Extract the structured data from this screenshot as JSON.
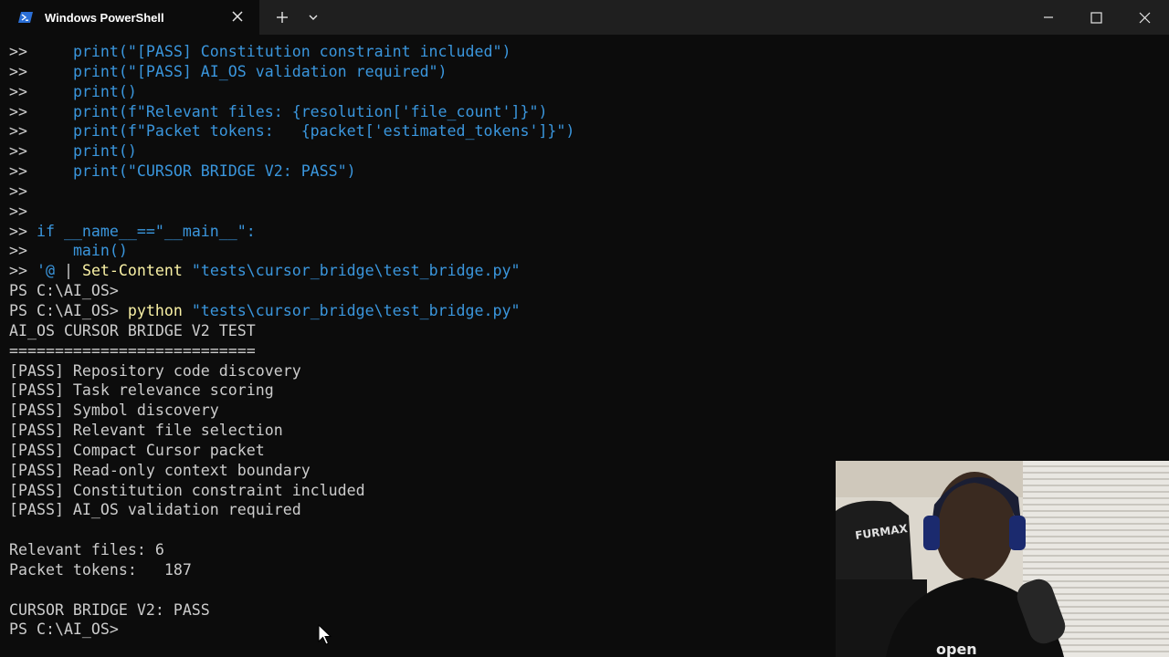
{
  "window": {
    "tab_title": "Windows PowerShell"
  },
  "terminal": {
    "lines": [
      [
        {
          "t": ">>     ",
          "c": "gray"
        },
        {
          "t": "print(\"[PASS] Constitution constraint included\")",
          "c": "blue"
        }
      ],
      [
        {
          "t": ">>     ",
          "c": "gray"
        },
        {
          "t": "print(\"[PASS] AI_OS validation required\")",
          "c": "blue"
        }
      ],
      [
        {
          "t": ">>     ",
          "c": "gray"
        },
        {
          "t": "print()",
          "c": "blue"
        }
      ],
      [
        {
          "t": ">>     ",
          "c": "gray"
        },
        {
          "t": "print(f\"Relevant files: {resolution['file_count']}\")",
          "c": "blue"
        }
      ],
      [
        {
          "t": ">>     ",
          "c": "gray"
        },
        {
          "t": "print(f\"Packet tokens:   {packet['estimated_tokens']}\")",
          "c": "blue"
        }
      ],
      [
        {
          "t": ">>     ",
          "c": "gray"
        },
        {
          "t": "print()",
          "c": "blue"
        }
      ],
      [
        {
          "t": ">>     ",
          "c": "gray"
        },
        {
          "t": "print(\"CURSOR BRIDGE V2: PASS\")",
          "c": "blue"
        }
      ],
      [
        {
          "t": ">>",
          "c": "gray"
        }
      ],
      [
        {
          "t": ">>",
          "c": "gray"
        }
      ],
      [
        {
          "t": ">> ",
          "c": "gray"
        },
        {
          "t": "if __name__==\"__main__\":",
          "c": "blue"
        }
      ],
      [
        {
          "t": ">>     ",
          "c": "gray"
        },
        {
          "t": "main()",
          "c": "blue"
        }
      ],
      [
        {
          "t": ">> ",
          "c": "gray"
        },
        {
          "t": "'@",
          "c": "blue"
        },
        {
          "t": " | ",
          "c": "gray"
        },
        {
          "t": "Set-Content",
          "c": "yellow"
        },
        {
          "t": " \"tests\\cursor_bridge\\test_bridge.py\"",
          "c": "blue"
        }
      ],
      [
        {
          "t": "PS C:\\AI_OS>",
          "c": "gray"
        }
      ],
      [
        {
          "t": "PS C:\\AI_OS> ",
          "c": "gray"
        },
        {
          "t": "python",
          "c": "yellow"
        },
        {
          "t": " \"tests\\cursor_bridge\\test_bridge.py\"",
          "c": "blue"
        }
      ],
      [
        {
          "t": "AI_OS CURSOR BRIDGE V2 TEST",
          "c": "gray"
        }
      ],
      [
        {
          "t": "===========================",
          "c": "gray"
        }
      ],
      [
        {
          "t": "[PASS] Repository code discovery",
          "c": "gray"
        }
      ],
      [
        {
          "t": "[PASS] Task relevance scoring",
          "c": "gray"
        }
      ],
      [
        {
          "t": "[PASS] Symbol discovery",
          "c": "gray"
        }
      ],
      [
        {
          "t": "[PASS] Relevant file selection",
          "c": "gray"
        }
      ],
      [
        {
          "t": "[PASS] Compact Cursor packet",
          "c": "gray"
        }
      ],
      [
        {
          "t": "[PASS] Read-only context boundary",
          "c": "gray"
        }
      ],
      [
        {
          "t": "[PASS] Constitution constraint included",
          "c": "gray"
        }
      ],
      [
        {
          "t": "[PASS] AI_OS validation required",
          "c": "gray"
        }
      ],
      [
        {
          "t": "",
          "c": "gray"
        }
      ],
      [
        {
          "t": "Relevant files: 6",
          "c": "gray"
        }
      ],
      [
        {
          "t": "Packet tokens:   187",
          "c": "gray"
        }
      ],
      [
        {
          "t": "",
          "c": "gray"
        }
      ],
      [
        {
          "t": "CURSOR BRIDGE V2: PASS",
          "c": "gray"
        }
      ],
      [
        {
          "t": "PS C:\\AI_OS>",
          "c": "gray"
        }
      ]
    ]
  },
  "webcam": {
    "chair_brand": "FURMAX"
  }
}
